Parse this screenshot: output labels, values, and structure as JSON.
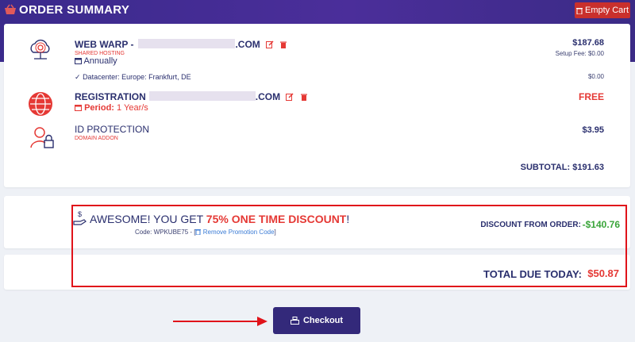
{
  "header": {
    "title": "ORDER SUMMARY",
    "empty_cart_label": "Empty Cart"
  },
  "items": [
    {
      "name": "WEB WARP -",
      "domain_suffix": ".COM",
      "category": "SHARED HOSTING",
      "cycle": "Annually",
      "price": "$187.68",
      "setup_fee": "Setup Fee: $0.00"
    },
    {
      "name": "REGISTRATION",
      "domain_suffix": ".COM",
      "period_label": "Period:",
      "period_value": "1 Year/s",
      "price": "FREE"
    },
    {
      "name": "ID PROTECTION",
      "category": "DOMAIN ADDON",
      "price": "$3.95"
    }
  ],
  "datacenter": {
    "text": "Datacenter: Europe: Frankfurt, DE",
    "price": "$0.00"
  },
  "subtotal": "SUBTOTAL: $191.63",
  "promo": {
    "prefix": "AWESOME! YOU GET ",
    "highlight": "75% ONE TIME DISCOUNT",
    "suffix": "!",
    "code_label": "Code: WPKUBE75 - [",
    "remove_label": "Remove Promotion Code",
    "code_close": "]",
    "discount_label": "DISCOUNT FROM ORDER:",
    "discount_value": "-$140.76"
  },
  "total": {
    "label": "TOTAL DUE TODAY:",
    "value": "$50.87"
  },
  "checkout_label": "Checkout",
  "colors": {
    "accent": "#33297a",
    "highlight": "#e53935",
    "discount": "#3aa53a",
    "annotation": "#e0131a"
  }
}
